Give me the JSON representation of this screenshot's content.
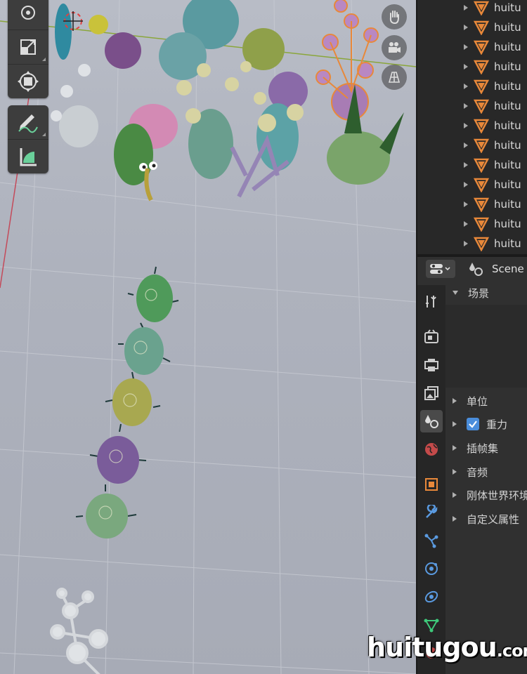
{
  "outliner": {
    "items": [
      "huitu",
      "huitu",
      "huitu",
      "huitu",
      "huitu",
      "huitu",
      "huitu",
      "huitu",
      "huitu",
      "huitu",
      "huitu",
      "huitu",
      "huitu"
    ]
  },
  "properties": {
    "header_scene_label": "Scene",
    "sections": {
      "scene": "场景",
      "units": "单位",
      "gravity": "重力",
      "keying_sets": "插帧集",
      "audio": "音频",
      "rigid_body_world": "刚体世界环境",
      "custom_props": "自定义属性"
    },
    "gravity_checked": true
  },
  "watermark": {
    "main": "huitugou",
    "suffix": ".com"
  },
  "colors": {
    "accent_orange": "#e8883a",
    "checkbox_blue": "#4a8ddb"
  }
}
